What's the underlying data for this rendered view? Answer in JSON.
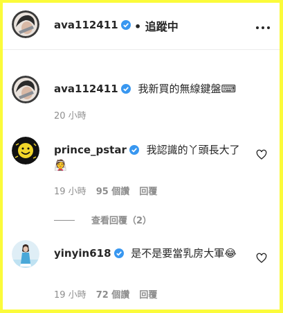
{
  "header": {
    "username": "ava112411",
    "follow_status": "• 追蹤中"
  },
  "caption": {
    "username": "ava112411",
    "text": "我新買的無線鍵盤⌨",
    "time": "20 小時"
  },
  "comments": [
    {
      "username": "prince_pstar",
      "text": "我認識的丫頭長大了👰",
      "time": "19 小時",
      "likes": "95 個讚",
      "reply": "回覆",
      "view_replies": "查看回覆（2）"
    },
    {
      "username": "yinyin618",
      "text": "是不是要當乳房大軍😂",
      "time": "19 小時",
      "likes": "72 個讚",
      "reply": "回覆"
    }
  ],
  "colors": {
    "border": "#fbfb3a",
    "verified": "#3897f0",
    "meta": "#8e8e8e"
  }
}
